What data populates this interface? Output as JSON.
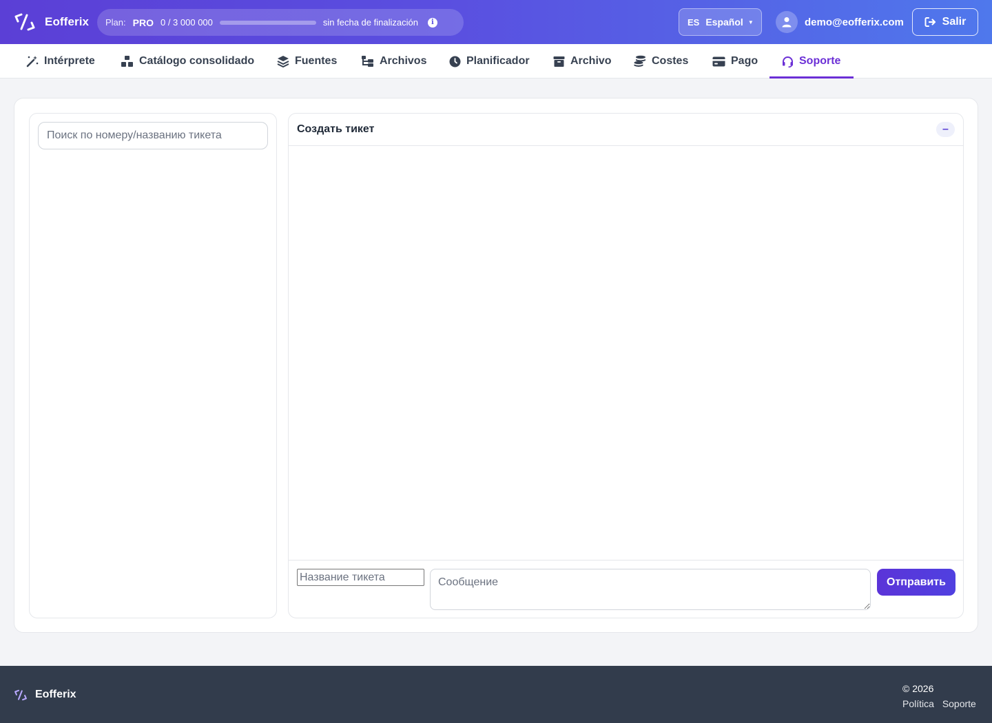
{
  "header": {
    "brand_name": "Eofferix",
    "plan": {
      "label": "Plan:",
      "name": "PRO",
      "usage_text": "0 / 3 000 000",
      "usage_fraction": 0.0,
      "expiry_text": "sin fecha de finalización"
    },
    "language": {
      "code": "ES",
      "name": "Español"
    },
    "user_email": "demo@eofferix.com",
    "logout_label": "Salir"
  },
  "nav": {
    "items": [
      {
        "label": "Intérprete",
        "icon": "magic-wand-icon"
      },
      {
        "label": "Catálogo consolidado",
        "icon": "boxes-icon"
      },
      {
        "label": "Fuentes",
        "icon": "layers-icon"
      },
      {
        "label": "Archivos",
        "icon": "folder-tree-icon"
      },
      {
        "label": "Planificador",
        "icon": "clock-icon"
      },
      {
        "label": "Archivo",
        "icon": "archive-box-icon"
      },
      {
        "label": "Costes",
        "icon": "coins-icon"
      },
      {
        "label": "Pago",
        "icon": "credit-card-icon"
      },
      {
        "label": "Soporte",
        "icon": "headset-icon"
      }
    ],
    "active": "Soporte"
  },
  "support": {
    "search_placeholder": "Поиск по номеру/названию тикета",
    "create_ticket_title": "Создать тикет",
    "collapse_symbol": "–",
    "ticket_title_placeholder": "Название тикета",
    "message_placeholder": "Сообщение",
    "send_label": "Отправить"
  },
  "footer": {
    "brand_name": "Eofferix",
    "copyright": "© 2026",
    "links": [
      "Política",
      "Soporte"
    ]
  },
  "colors": {
    "accent": "#6b2fd6",
    "header_gradient_start": "#5b3fd6",
    "header_gradient_end": "#4f78ec",
    "footer_bg": "#323c4c"
  }
}
